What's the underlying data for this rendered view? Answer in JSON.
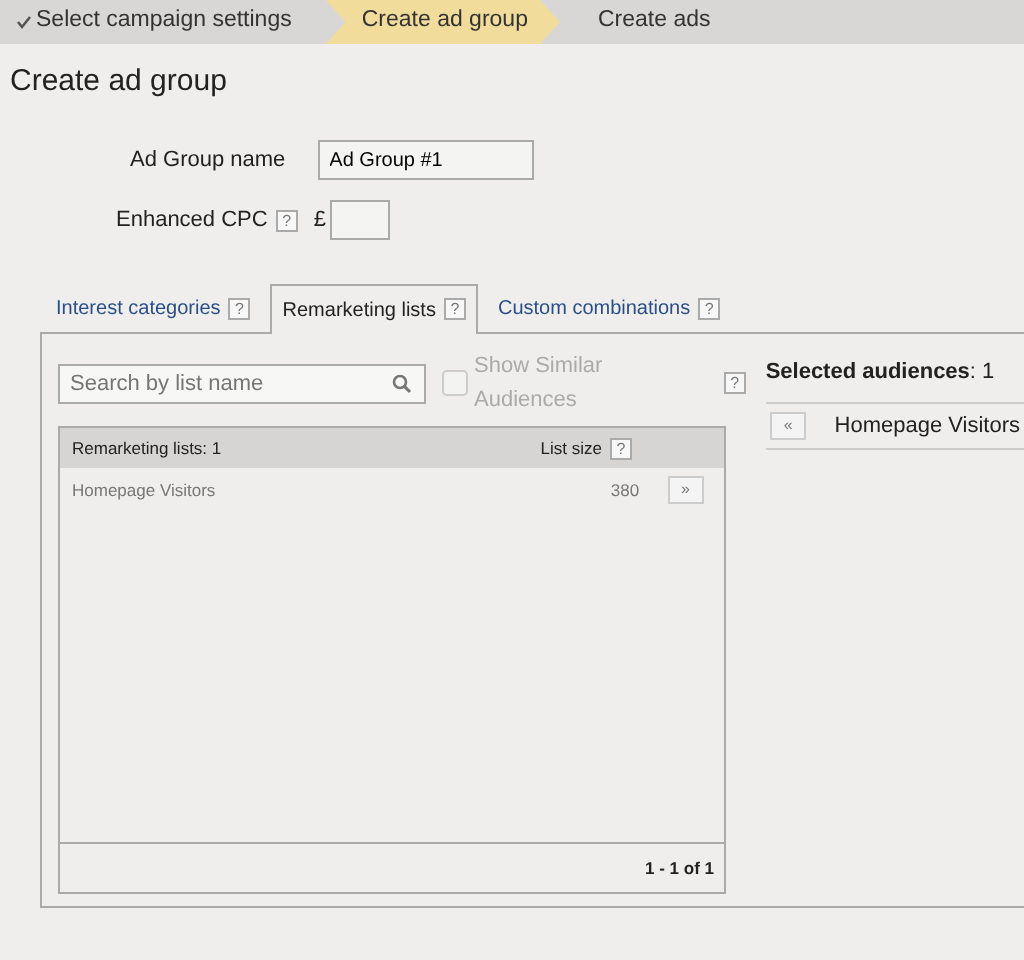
{
  "steps": [
    {
      "label": "Select campaign settings",
      "done": true,
      "selected": false
    },
    {
      "label": "Create ad group",
      "done": false,
      "selected": true
    },
    {
      "label": "Create ads",
      "done": false,
      "selected": false
    }
  ],
  "title": "Create ad group",
  "form": {
    "name_label": "Ad Group name",
    "name_value": "Ad Group #1",
    "cpc_label": "Enhanced CPC",
    "cpc_help": "?",
    "currency": "£"
  },
  "tabs": [
    {
      "label": "Interest categories",
      "help": "?",
      "selected": false
    },
    {
      "label": "Remarketing lists",
      "help": "?",
      "selected": true
    },
    {
      "label": "Custom combinations",
      "help": "?",
      "selected": false
    }
  ],
  "search": {
    "placeholder": "Search by list name"
  },
  "similar": {
    "label": "Show Similar Audiences",
    "help": "?",
    "checked": false,
    "disabled": true
  },
  "list": {
    "header": "Remarketing lists: 1",
    "size_header": "List size",
    "size_help": "?",
    "rows": [
      {
        "name": "Homepage Visitors",
        "size": "380",
        "add": "»"
      }
    ],
    "pager": "1 - 1 of 1"
  },
  "selected": {
    "label": "Selected audiences",
    "count": ": 1",
    "items": [
      {
        "remove": "«",
        "name": "Homepage Visitors"
      }
    ]
  }
}
